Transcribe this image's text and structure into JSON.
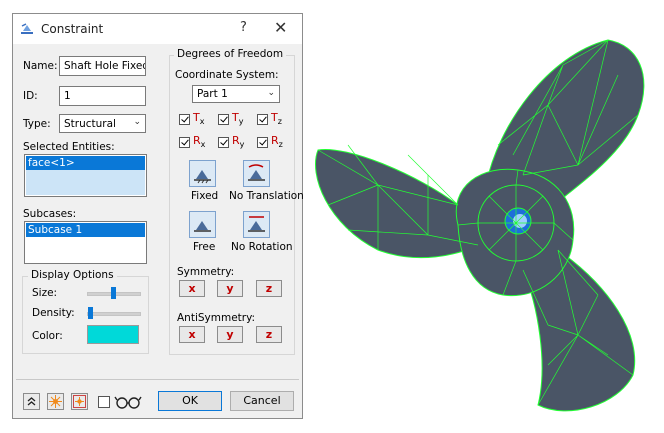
{
  "dialog": {
    "title": "Constraint",
    "help_glyph": "?",
    "close_glyph": "✕"
  },
  "fields": {
    "name_label": "Name:",
    "name_value": "Shaft Hole Fixed",
    "id_label": "ID:",
    "id_value": "1",
    "type_label": "Type:",
    "type_value": "Structural",
    "entities_label": "Selected Entities:",
    "entities_items": [
      "face<1>"
    ],
    "subcases_label": "Subcases:",
    "subcases_items": [
      "Subcase 1"
    ]
  },
  "display_options": {
    "title": "Display Options",
    "size_label": "Size:",
    "size_level": 0.5,
    "density_label": "Density:",
    "density_level": 0.05,
    "color_label": "Color:",
    "color": "#00d9d9"
  },
  "dof": {
    "title": "Degrees of Freedom",
    "coord_label": "Coordinate System:",
    "coord_value": "Part 1",
    "translations": [
      {
        "letter": "T",
        "axis": "x",
        "checked": true
      },
      {
        "letter": "T",
        "axis": "y",
        "checked": true
      },
      {
        "letter": "T",
        "axis": "z",
        "checked": true
      }
    ],
    "rotations": [
      {
        "letter": "R",
        "axis": "x",
        "checked": true
      },
      {
        "letter": "R",
        "axis": "y",
        "checked": true
      },
      {
        "letter": "R",
        "axis": "z",
        "checked": true
      }
    ],
    "presets": [
      {
        "label": "Fixed",
        "icon": "fixed-support-icon"
      },
      {
        "label": "No Translation",
        "icon": "no-translation-icon"
      },
      {
        "label": "Free",
        "icon": "free-support-icon"
      },
      {
        "label": "No Rotation",
        "icon": "no-rotation-icon"
      }
    ],
    "symmetry_label": "Symmetry:",
    "antisymmetry_label": "AntiSymmetry:",
    "axis_buttons": [
      "x",
      "y",
      "z"
    ]
  },
  "footer": {
    "tools": [
      "expand-icon",
      "star-burst-icon",
      "star-burst-box-icon"
    ],
    "ok_label": "OK",
    "cancel_label": "Cancel"
  },
  "colors": {
    "accent": "#0a78d7",
    "dof_letter": "#c00000",
    "mesh_surface": "#4a5566",
    "mesh_edges": "#22ff33"
  }
}
